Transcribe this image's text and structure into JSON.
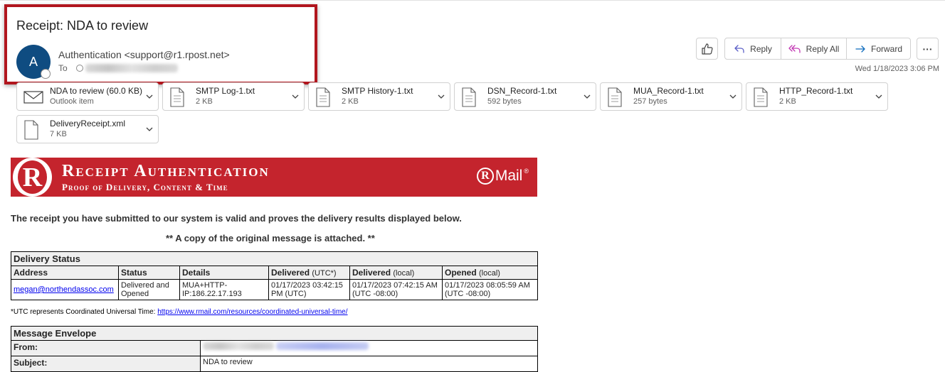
{
  "email": {
    "subject": "Receipt: NDA to review",
    "avatar_initial": "A",
    "sender": "Authentication <support@r1.rpost.net>",
    "to_label": "To",
    "datetime": "Wed 1/18/2023 3:06 PM"
  },
  "toolbar": {
    "reply": "Reply",
    "reply_all": "Reply All",
    "forward": "Forward",
    "more_glyph": "···"
  },
  "attachments": [
    {
      "name": "NDA to review (60.0 KB)",
      "size": "Outlook item",
      "icon": "envelope-icon"
    },
    {
      "name": "SMTP Log-1.txt",
      "size": "2 KB",
      "icon": "document-icon"
    },
    {
      "name": "SMTP History-1.txt",
      "size": "2 KB",
      "icon": "document-icon"
    },
    {
      "name": "DSN_Record-1.txt",
      "size": "592 bytes",
      "icon": "document-icon"
    },
    {
      "name": "MUA_Record-1.txt",
      "size": "257 bytes",
      "icon": "document-icon"
    },
    {
      "name": "HTTP_Record-1.txt",
      "size": "2 KB",
      "icon": "document-icon"
    },
    {
      "name": "DeliveryReceipt.xml",
      "size": "7 KB",
      "icon": "document-icon"
    }
  ],
  "banner": {
    "title": "Receipt Authentication",
    "subtitle": "Proof of Delivery, Content & Time",
    "logo_letter": "R",
    "brand_r": "R",
    "brand_text": "Mail",
    "brand_mark": "®",
    "color": "#c4242d"
  },
  "body": {
    "valid_text": "The receipt you have submitted to our system is valid and proves the delivery results displayed below.",
    "copy_text": "** A copy of the original message is attached. **"
  },
  "delivery_status": {
    "title": "Delivery Status",
    "headers": {
      "address": "Address",
      "status": "Status",
      "details": "Details",
      "delivered": "Delivered",
      "delivered_utc": "(UTC*)",
      "delivered_local_label": "Delivered",
      "delivered_local": "(local)",
      "opened": "Opened",
      "opened_local": "(local)"
    },
    "row": {
      "address": "megan@northendassoc.com",
      "status": "Delivered and Opened",
      "details": "MUA+HTTP-IP:186.22.17.193",
      "delivered_utc": "01/17/2023 03:42:15 PM (UTC)",
      "delivered_local": "01/17/2023 07:42:15 AM (UTC -08:00)",
      "opened_local": "01/17/2023 08:05:59 AM (UTC -08:00)"
    },
    "footnote": "*UTC represents Coordinated Universal Time: ",
    "footnote_link": "https://www.rmail.com/resources/coordinated-universal-time/"
  },
  "envelope": {
    "title": "Message Envelope",
    "from_label": "From:",
    "subject_label": "Subject:",
    "subject_value": "NDA to review"
  }
}
